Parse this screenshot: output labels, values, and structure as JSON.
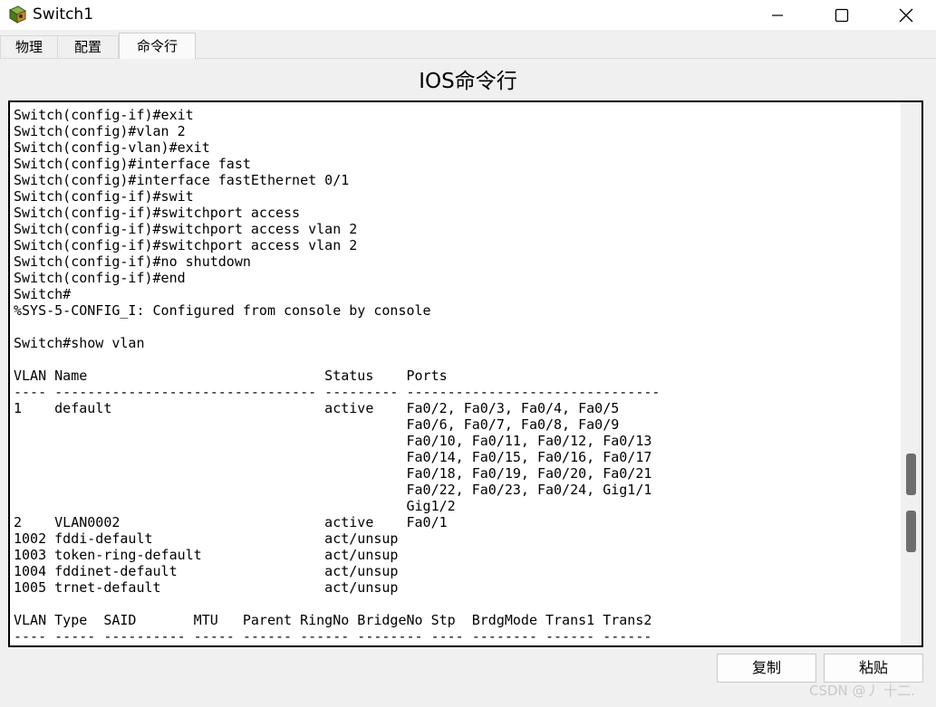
{
  "window": {
    "title": "Switch1",
    "app_icon": "packet-tracer-switch-icon",
    "controls": [
      "minimize-icon",
      "maximize-icon",
      "close-icon"
    ]
  },
  "tabs": [
    {
      "label": "物理",
      "active": false
    },
    {
      "label": "配置",
      "active": false
    },
    {
      "label": "命令行",
      "active": true
    }
  ],
  "heading": "IOS命令行",
  "console": {
    "lines": [
      "Switch(config-if)#exit",
      "Switch(config)#vlan 2",
      "Switch(config-vlan)#exit",
      "Switch(config)#interface fast",
      "Switch(config)#interface fastEthernet 0/1",
      "Switch(config-if)#swit",
      "Switch(config-if)#switchport access",
      "Switch(config-if)#switchport access vlan 2",
      "Switch(config-if)#switchport access vlan 2",
      "Switch(config-if)#no shutdown",
      "Switch(config-if)#end",
      "Switch#",
      "%SYS-5-CONFIG_I: Configured from console by console",
      "",
      "Switch#show vlan",
      "",
      "VLAN Name                             Status    Ports",
      "---- -------------------------------- --------- -------------------------------",
      "1    default                          active    Fa0/2, Fa0/3, Fa0/4, Fa0/5",
      "                                                Fa0/6, Fa0/7, Fa0/8, Fa0/9",
      "                                                Fa0/10, Fa0/11, Fa0/12, Fa0/13",
      "                                                Fa0/14, Fa0/15, Fa0/16, Fa0/17",
      "                                                Fa0/18, Fa0/19, Fa0/20, Fa0/21",
      "                                                Fa0/22, Fa0/23, Fa0/24, Gig1/1",
      "                                                Gig1/2",
      "2    VLAN0002                         active    Fa0/1",
      "1002 fddi-default                     act/unsup",
      "1003 token-ring-default               act/unsup",
      "1004 fddinet-default                  act/unsup",
      "1005 trnet-default                    act/unsup",
      "",
      "VLAN Type  SAID       MTU   Parent RingNo BridgeNo Stp  BrdgMode Trans1 Trans2",
      "---- ----- ---------- ----- ------ ------ -------- ---- -------- ------ ------"
    ]
  },
  "buttons": {
    "copy": "复制",
    "paste": "粘贴"
  },
  "watermark": "CSDN @丿 十二."
}
